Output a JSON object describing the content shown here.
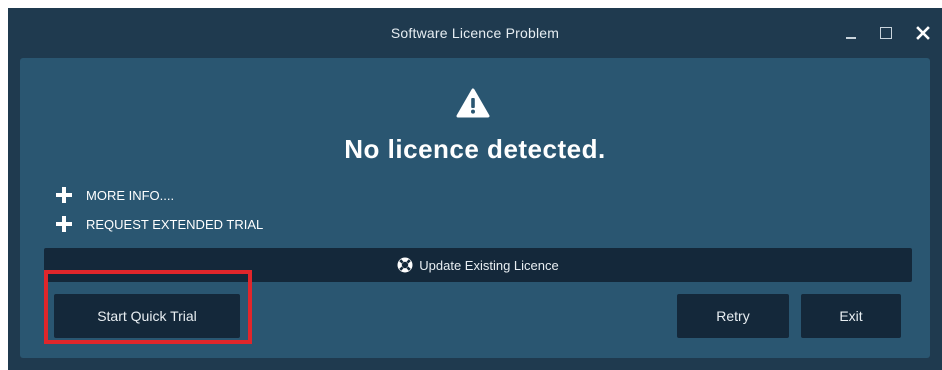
{
  "window": {
    "title": "Software Licence Problem"
  },
  "dialog": {
    "headline": "No licence detected.",
    "more_info_label": "MORE INFO....",
    "request_trial_label": "REQUEST EXTENDED TRIAL",
    "update_label": "Update Existing Licence"
  },
  "buttons": {
    "start_trial": "Start Quick Trial",
    "retry": "Retry",
    "exit": "Exit"
  },
  "colors": {
    "window_bg": "#1f3a4f",
    "panel_bg": "#2a5671",
    "button_bg": "#14283a",
    "highlight": "#e0262b"
  }
}
